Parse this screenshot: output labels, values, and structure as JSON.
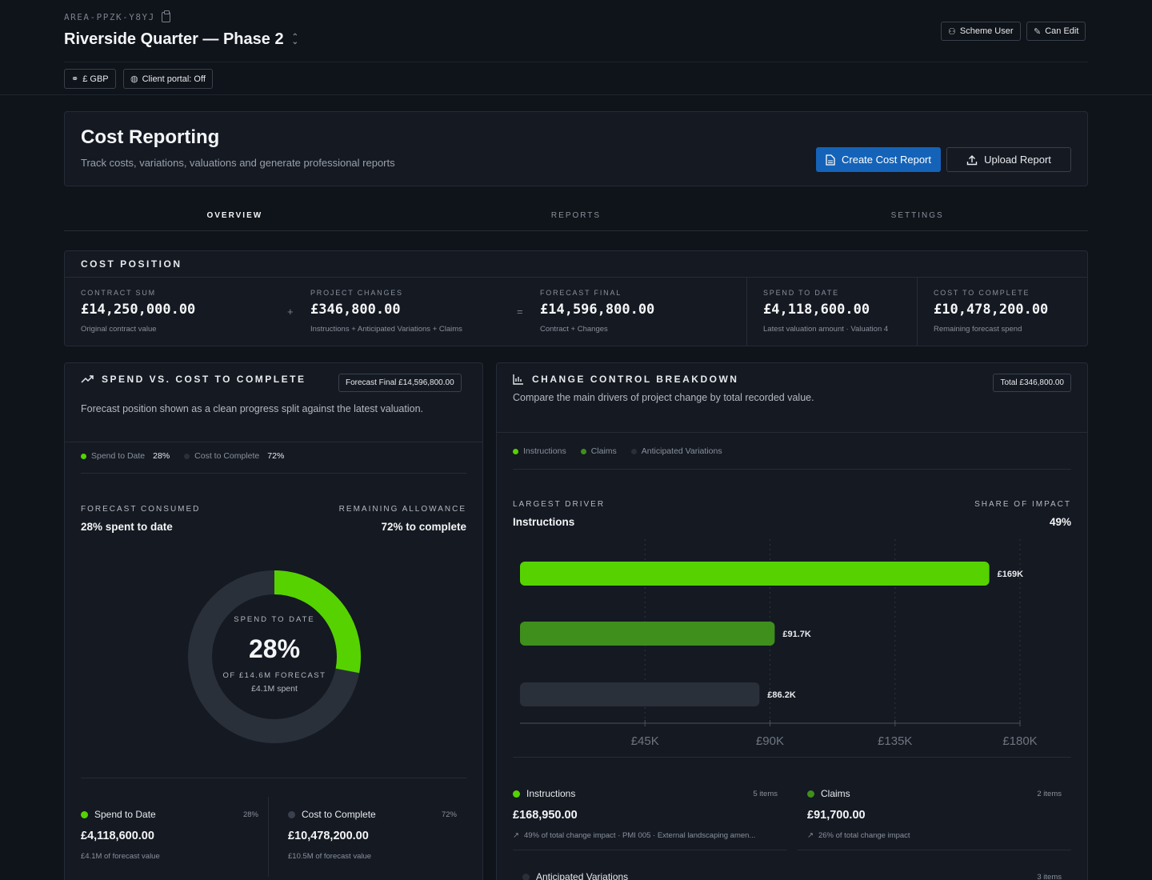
{
  "header": {
    "area_id": "AREA-PPZK-Y8YJ",
    "project_title": "Riverside Quarter — Phase 2",
    "scheme_user_label": "Scheme User",
    "can_edit_label": "Can Edit",
    "currency_label": "£ GBP",
    "client_portal_label": "Client portal: Off"
  },
  "cost_reporting": {
    "title": "Cost Reporting",
    "subtitle": "Track costs, variations, valuations and generate professional reports",
    "create_label": "Create Cost Report",
    "upload_label": "Upload Report"
  },
  "tabs": [
    {
      "label": "OVERVIEW",
      "active": true
    },
    {
      "label": "REPORTS",
      "active": false
    },
    {
      "label": "SETTINGS",
      "active": false
    }
  ],
  "cost_position": {
    "title": "COST POSITION",
    "plus": "+",
    "equals": "=",
    "kpis": [
      {
        "label": "CONTRACT SUM",
        "value": "£14,250,000.00",
        "note": "Original contract value"
      },
      {
        "label": "PROJECT CHANGES",
        "value": "£346,800.00",
        "note": "Instructions + Anticipated Variations + Claims"
      },
      {
        "label": "FORECAST FINAL",
        "value": "£14,596,800.00",
        "note": "Contract + Changes"
      },
      {
        "label": "SPEND TO DATE",
        "value": "£4,118,600.00",
        "note": "Latest valuation amount · Valuation 4"
      },
      {
        "label": "COST TO COMPLETE",
        "value": "£10,478,200.00",
        "note": "Remaining forecast spend"
      }
    ]
  },
  "spend_panel": {
    "title": "SPEND VS. COST TO COMPLETE",
    "badge": "Forecast Final £14,596,800.00",
    "subtitle": "Forecast position shown as a clean progress split against the latest valuation.",
    "legend": [
      {
        "label": "Spend to Date",
        "pct": "28%",
        "color": "#56d200"
      },
      {
        "label": "Cost to Complete",
        "pct": "72%",
        "color": "#2a3039"
      }
    ],
    "left_caption": "FORECAST CONSUMED",
    "left_value": "28% spent to date",
    "right_caption": "REMAINING ALLOWANCE",
    "right_value": "72% to complete",
    "donut": {
      "fraction": 0.28,
      "top_label": "SPEND TO DATE",
      "center": "28%",
      "sub1": "OF £14.6M FORECAST",
      "sub2": "£4.1M spent",
      "color_spend": "#56d200",
      "color_rest": "#2a3039"
    },
    "cards": [
      {
        "title": "Spend to Date",
        "pct": "28%",
        "value": "£4,118,600.00",
        "note": "£4.1M of forecast value",
        "color": "#56d200"
      },
      {
        "title": "Cost to Complete",
        "pct": "72%",
        "value": "£10,478,200.00",
        "note": "£10.5M of forecast value",
        "color": "#3a414c"
      }
    ]
  },
  "change_panel": {
    "title": "CHANGE CONTROL BREAKDOWN",
    "badge": "Total £346,800.00",
    "subtitle": "Compare the main drivers of project change by total recorded value.",
    "legend": [
      {
        "label": "Instructions",
        "color": "#56d200"
      },
      {
        "label": "Claims",
        "color": "#3f8f1c"
      },
      {
        "label": "Anticipated Variations",
        "color": "#2a3039"
      }
    ],
    "largest_caption": "LARGEST DRIVER",
    "largest_value": "Instructions",
    "share_caption": "SHARE OF IMPACT",
    "share_value": "49%",
    "items": [
      {
        "title": "Instructions",
        "count": "5 items",
        "value": "£168,950.00",
        "note": "49% of total change impact · PMI 005 · External landscaping amen...",
        "color": "#56d200"
      },
      {
        "title": "Claims",
        "count": "2 items",
        "value": "£91,700.00",
        "note": "26% of total change impact",
        "color": "#3f8f1c"
      },
      {
        "title": "Anticipated Variations",
        "count": "3 items",
        "color": "#2a3039"
      }
    ]
  },
  "chart_data": {
    "type": "bar",
    "orientation": "horizontal",
    "categories": [
      "Instructions",
      "Claims",
      "Anticipated Variations"
    ],
    "values": [
      168950,
      91700,
      86200
    ],
    "data_labels": [
      "£169K",
      "£91.7K",
      "£86.2K"
    ],
    "colors": [
      "#56d200",
      "#3f8f1c",
      "#2a3039"
    ],
    "xlim": [
      0,
      180000
    ],
    "xticks": [
      45000,
      90000,
      135000,
      180000
    ],
    "xtick_labels": [
      "£45K",
      "£90K",
      "£135K",
      "£180K"
    ],
    "grid": true
  }
}
